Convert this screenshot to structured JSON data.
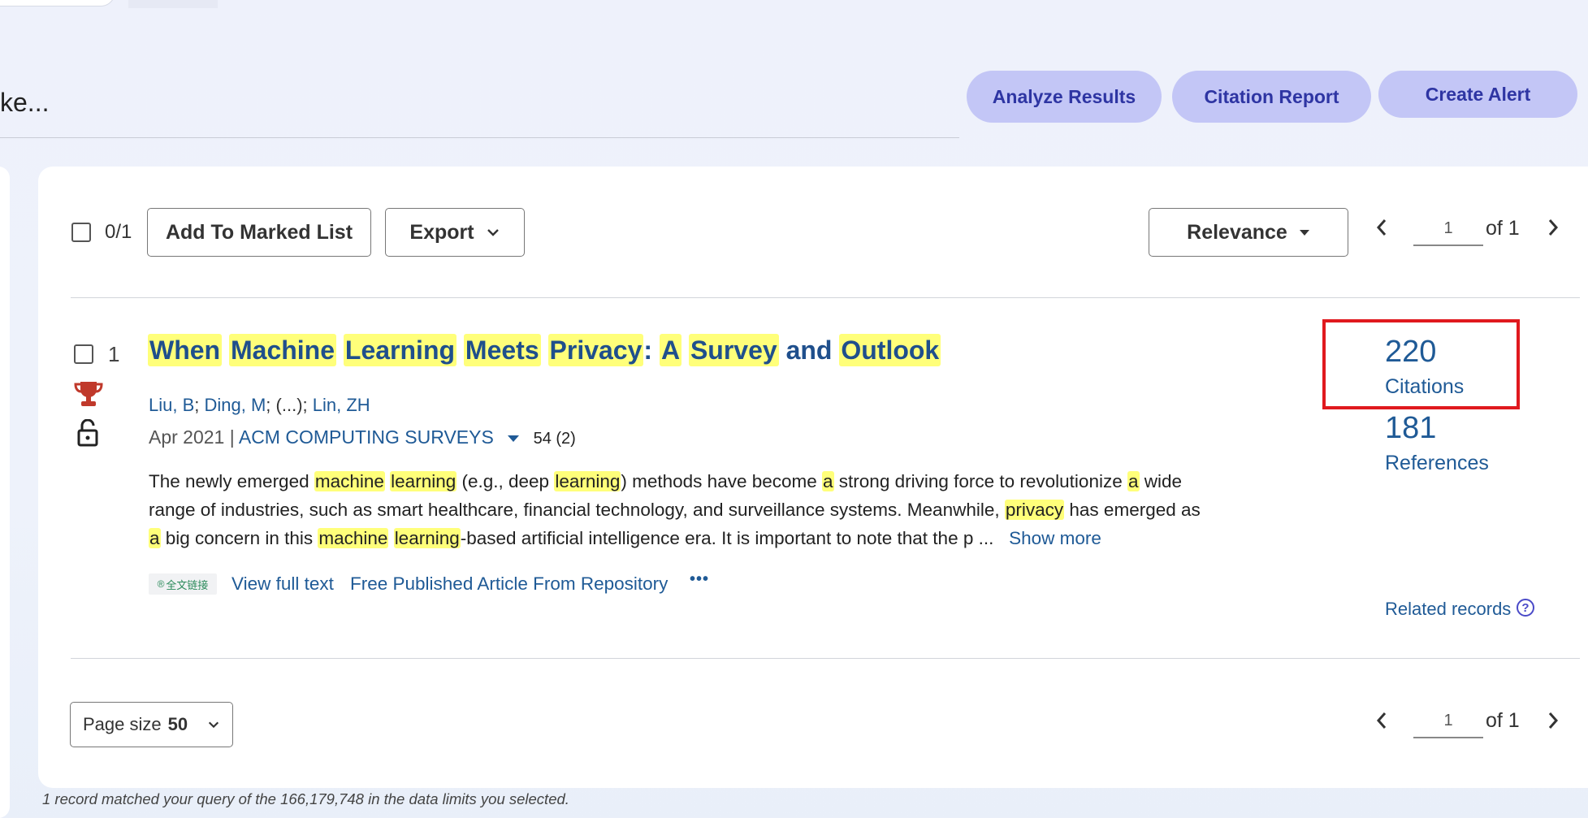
{
  "query": {
    "truncated_text": "ke..."
  },
  "actions": {
    "analyze_label": "Analyze Results",
    "citation_report_label": "Citation Report",
    "create_alert_label": "Create Alert"
  },
  "toolbar": {
    "selected_count": "0/1",
    "add_to_marked_list_label": "Add To Marked List",
    "export_label": "Export",
    "sort_label": "Relevance",
    "page_value": "1",
    "page_of": "of 1"
  },
  "record": {
    "index": "1",
    "title_parts": [
      "When",
      "Machine",
      "Learning",
      "Meets",
      "Privacy",
      ":",
      "A",
      "Survey",
      "and",
      "Outlook"
    ],
    "authors": [
      "Liu, B",
      "Ding, M",
      "(...)",
      "Lin, ZH"
    ],
    "date": "Apr 2021",
    "separator": "|",
    "journal": "ACM COMPUTING SURVEYS",
    "journal_meta": "54 (2)",
    "abstract_lines": [
      "The newly emerged machine learning (e.g., deep learning) methods have become a strong driving force to revolutionize a wide",
      "range of industries, such as smart healthcare, financial technology, and surveillance systems. Meanwhile, privacy has emerged as",
      "a big concern in this machine learning-based artificial intelligence era. It is important to note that the p ..."
    ],
    "show_more_label": "Show more",
    "fulltext_badge": "全文链接",
    "view_full_text_label": "View full text",
    "free_article_label": "Free Published Article From Repository",
    "more_label": "•••",
    "citations_count": "220",
    "citations_label": "Citations",
    "references_count": "181",
    "references_label": "References",
    "related_records_label": "Related records",
    "help_symbol": "?"
  },
  "bottom": {
    "page_size_label": "Page size",
    "page_size_value": "50",
    "page_value": "1",
    "page_of": "of 1"
  },
  "footer_note": "1 record matched your query of the 166,179,748 in the data limits you selected.",
  "colors": {
    "highlight": "#ffff7a",
    "link": "#1f5a96",
    "pill": "#c3c6f6",
    "annotation_box": "#e0191e"
  },
  "icons": [
    "checkbox-icon",
    "chevron-down-icon",
    "caret-down-icon",
    "chevron-left-icon",
    "chevron-right-icon",
    "trophy-icon",
    "unlock-icon",
    "ellipsis-icon",
    "help-icon"
  ]
}
